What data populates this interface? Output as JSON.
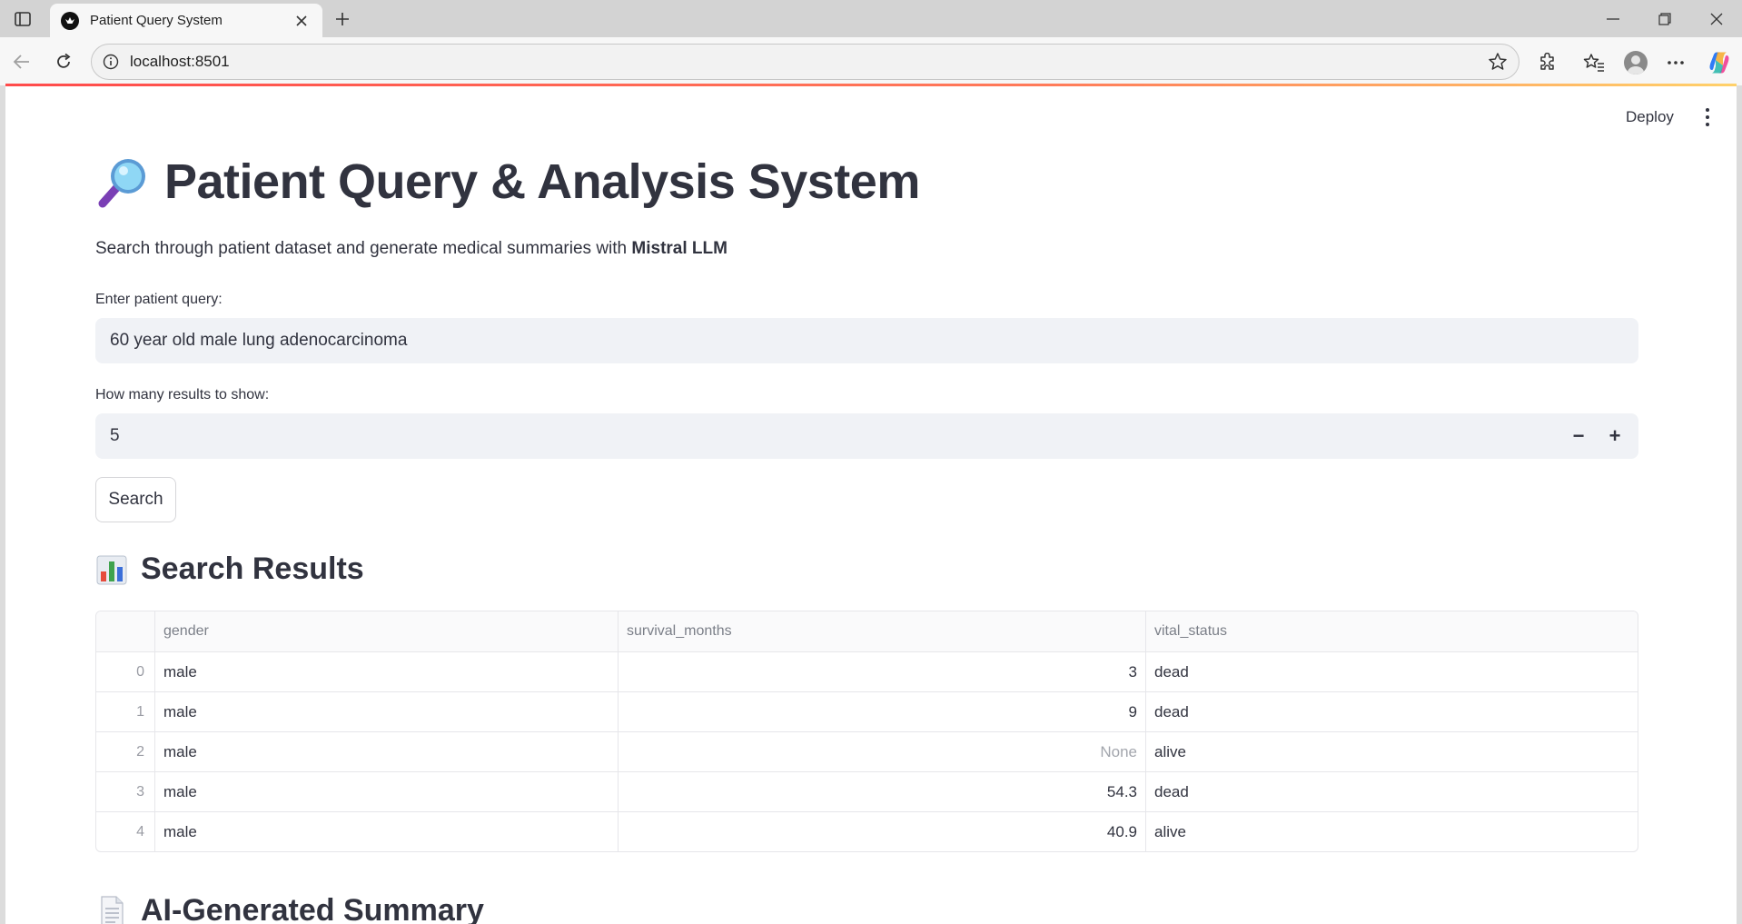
{
  "browser": {
    "tab_title": "Patient Query System",
    "url": "localhost:8501"
  },
  "app": {
    "deploy_label": "Deploy",
    "title": "Patient Query & Analysis System",
    "subtitle_prefix": "Search through patient dataset and generate medical summaries with ",
    "subtitle_bold": "Mistral LLM",
    "query_label": "Enter patient query:",
    "query_value": "60 year old male lung adenocarcinoma",
    "results_label": "How many results to show:",
    "results_value": "5",
    "minus_label": "−",
    "plus_label": "+",
    "search_button": "Search",
    "results_heading": "Search Results",
    "summary_heading": "AI-Generated Summary"
  },
  "table": {
    "columns": [
      "gender",
      "survival_months",
      "vital_status"
    ],
    "rows": [
      {
        "index": "0",
        "gender": "male",
        "survival_months": "3",
        "vital_status": "dead"
      },
      {
        "index": "1",
        "gender": "male",
        "survival_months": "9",
        "vital_status": "dead"
      },
      {
        "index": "2",
        "gender": "male",
        "survival_months": "None",
        "vital_status": "alive"
      },
      {
        "index": "3",
        "gender": "male",
        "survival_months": "54.3",
        "vital_status": "dead"
      },
      {
        "index": "4",
        "gender": "male",
        "survival_months": "40.9",
        "vital_status": "alive"
      }
    ]
  },
  "icons": {
    "title_icon": "magnifying-glass-icon",
    "results_icon": "bar-chart-icon",
    "summary_icon": "document-icon"
  },
  "colors": {
    "accent": "#ff4b4b",
    "text": "#31333f",
    "input_bg": "#f0f2f6"
  }
}
